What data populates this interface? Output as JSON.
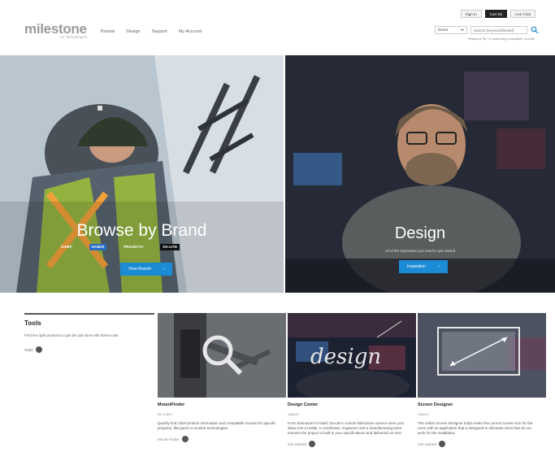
{
  "header": {
    "logo_text": "milestone",
    "logo_sub": "AV Technologies",
    "nav": [
      "Brands",
      "Design",
      "Support",
      "My Account"
    ],
    "util_buttons": [
      "Sign In",
      "Cart (0)",
      "Live Chat"
    ],
    "search": {
      "category": "Brand",
      "placeholder": "Search (Keyword/Model)",
      "hint": "Required Tip: To searching compatible mounts"
    }
  },
  "hero_brand": {
    "title": "Browse by Brand",
    "brands": [
      "CHIEF",
      "SANUS",
      "PROJECTA",
      "DA-LITE"
    ],
    "button": "View Brands"
  },
  "hero_design": {
    "title": "Design",
    "subtitle": "All of the inspiration you need to get started",
    "button": "Inspiration"
  },
  "tools": {
    "title": "Tools",
    "description": "Find the right products to get the job done with these tools",
    "link": "Tools"
  },
  "cards": [
    {
      "title": "MountFinder",
      "tag": "BY CHIEF",
      "description": "Quickly find Chief product information and compatible mounts for specific projector, flat panel or monitor technologies",
      "link": "Mount Finder"
    },
    {
      "title": "Design Center",
      "tag": "SANUS",
      "description": "From brainstorm to build: Da-Lite's custom fabrication service turns your ideas into a reality. A coordinator, engineers and a manufacturing team ensures the project is built to your specifications and delivered on time",
      "link": "Get Started"
    },
    {
      "title": "Screen Designer",
      "tag": "SANUS",
      "description": "The online Screen Designer helps select the correct screen size for the room with an application that is designed to eliminate sizes that do not work for the installation",
      "link": "Get Started"
    }
  ],
  "colors": {
    "accent": "#1b8bd6",
    "dark": "#222222"
  }
}
